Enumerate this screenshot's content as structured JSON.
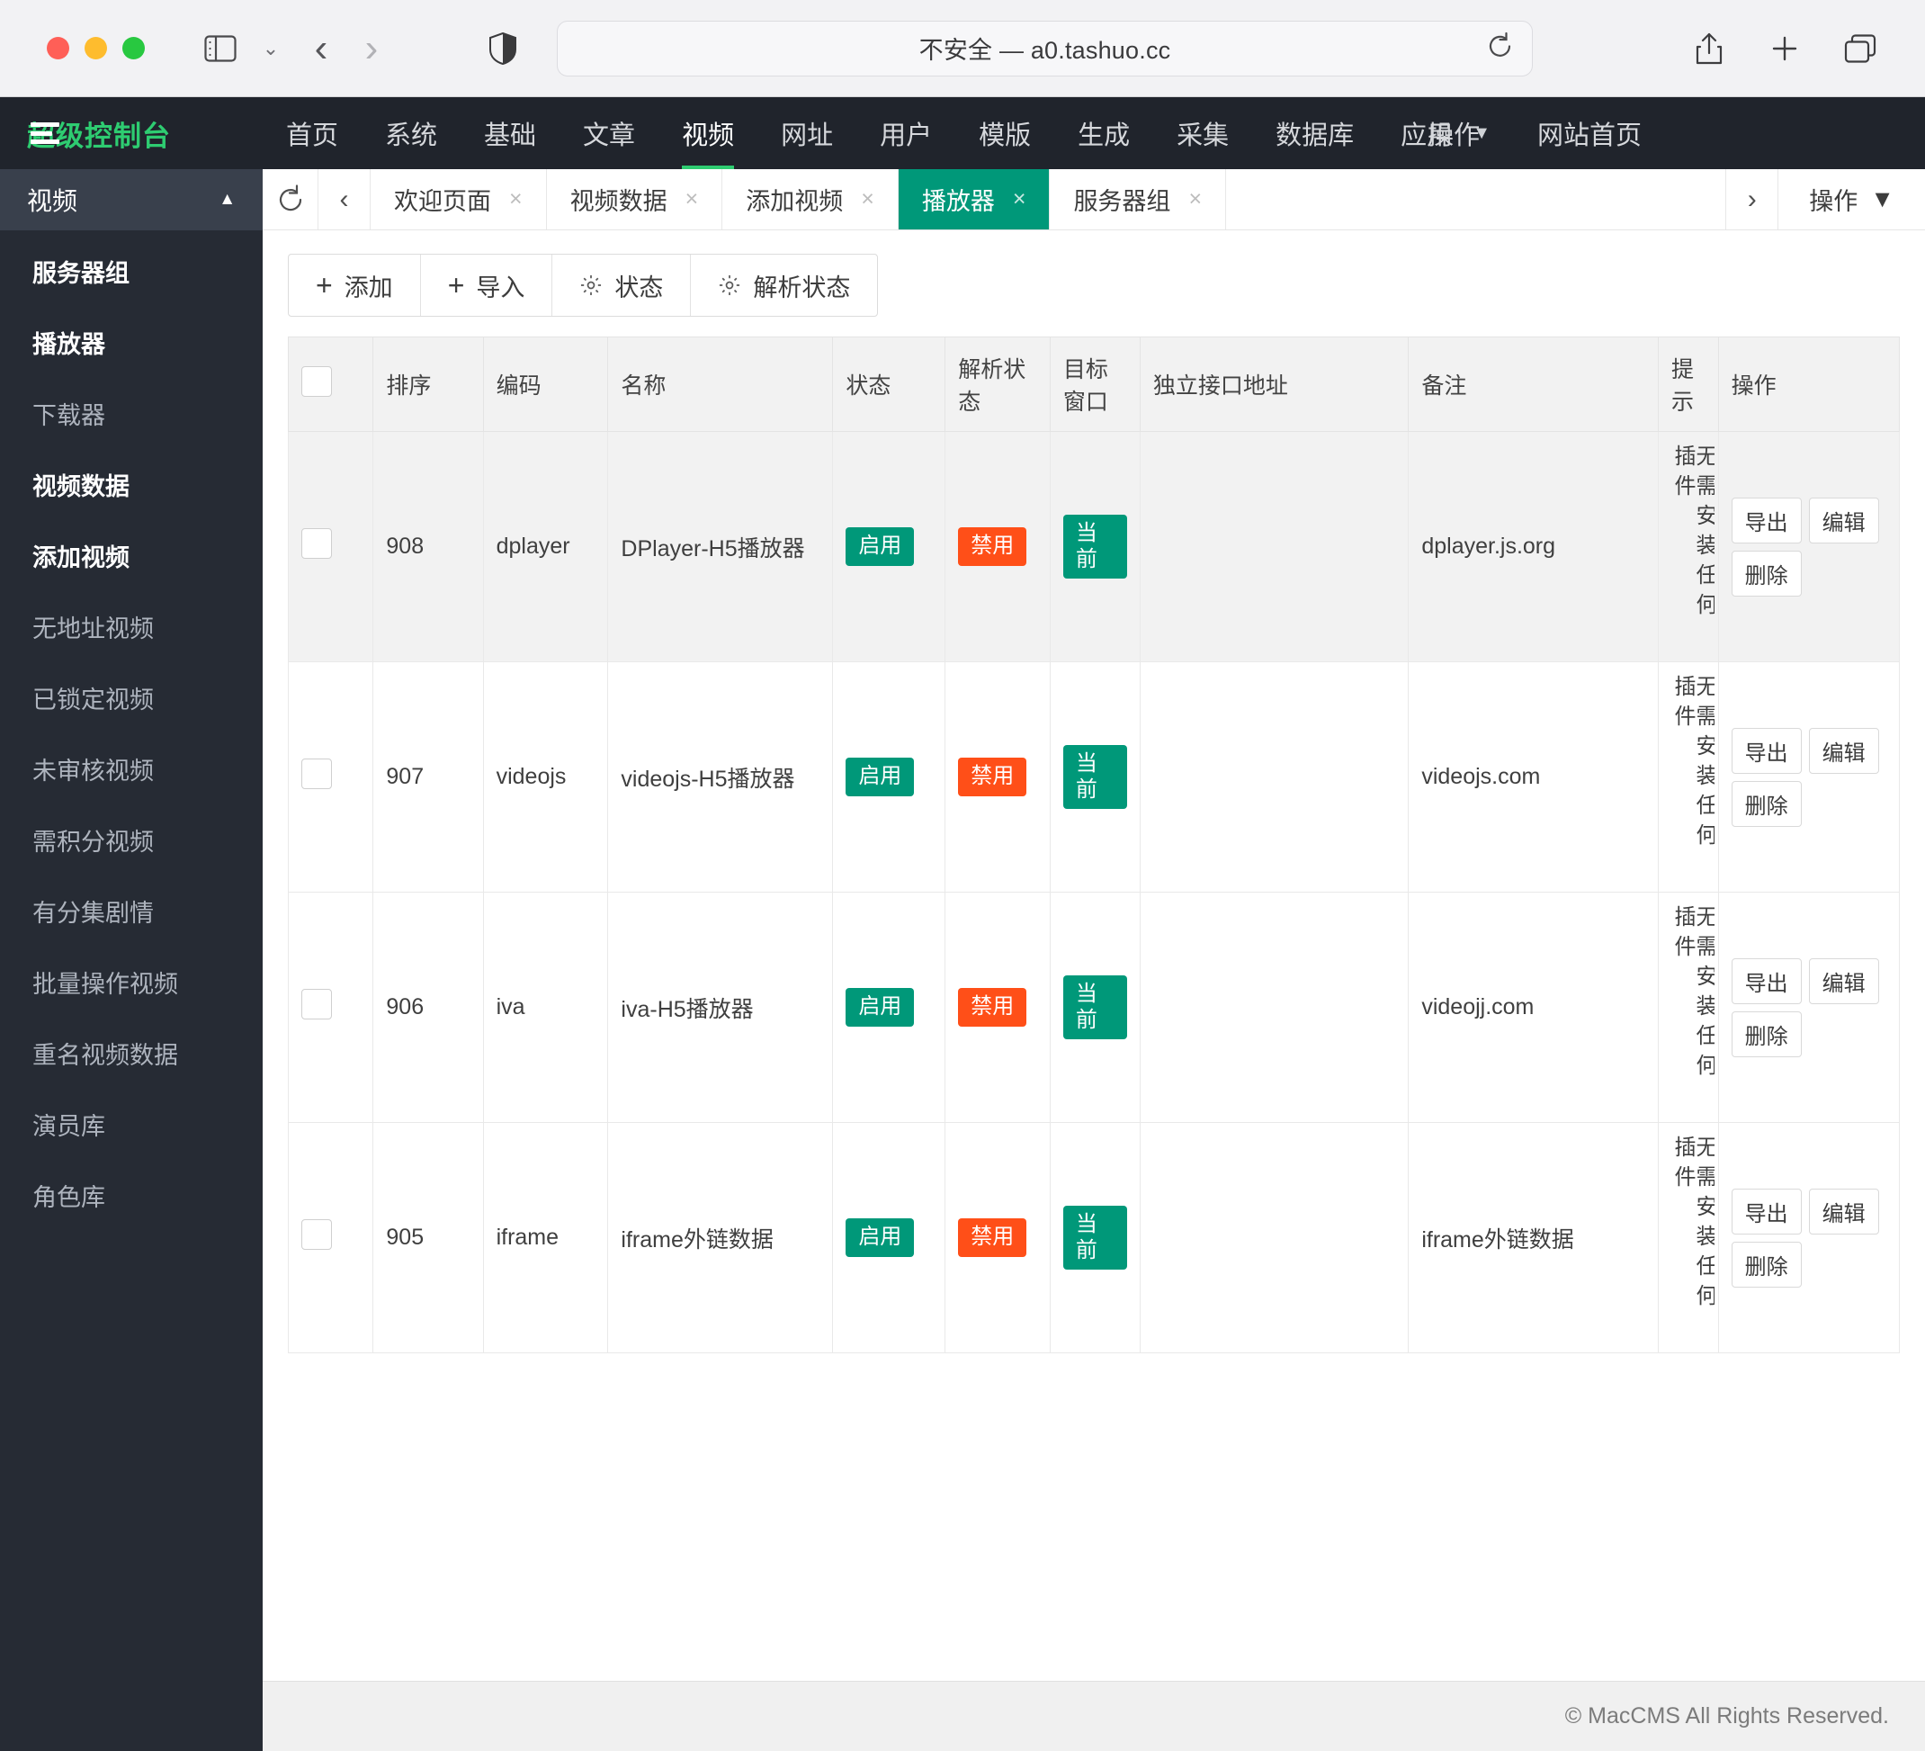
{
  "browser": {
    "url_text": "不安全 — a0.tashuo.cc",
    "icons": {
      "sidebar": "sidebar-toggle-icon",
      "sidebar_chevron": "chevron-down-icon",
      "back": "back-arrow-icon",
      "forward": "forward-arrow-icon",
      "shield": "privacy-shield-icon",
      "reload": "reload-icon",
      "share": "share-icon",
      "newtab": "new-tab-icon",
      "tabs": "show-tabs-icon"
    }
  },
  "topnav": {
    "logo": "超级控制台",
    "logo_color": "#2ecc71",
    "items": [
      {
        "label": "首页",
        "active": false
      },
      {
        "label": "系统",
        "active": false
      },
      {
        "label": "基础",
        "active": false
      },
      {
        "label": "文章",
        "active": false
      },
      {
        "label": "视频",
        "active": true
      },
      {
        "label": "网址",
        "active": false
      },
      {
        "label": "用户",
        "active": false
      },
      {
        "label": "模版",
        "active": false
      },
      {
        "label": "生成",
        "active": false
      },
      {
        "label": "采集",
        "active": false
      },
      {
        "label": "数据库",
        "active": false
      }
    ],
    "overlap_item": {
      "front": "应用",
      "back": "操作",
      "caret": "▼"
    },
    "site_home": "网站首页"
  },
  "sidebar": {
    "title": "视频",
    "collapse_icon": "▲",
    "items": [
      {
        "label": "服务器组",
        "strong": true
      },
      {
        "label": "播放器",
        "strong": true
      },
      {
        "label": "下载器",
        "strong": false
      },
      {
        "label": "视频数据",
        "strong": true
      },
      {
        "label": "添加视频",
        "strong": true
      },
      {
        "label": "无地址视频",
        "strong": false
      },
      {
        "label": "已锁定视频",
        "strong": false
      },
      {
        "label": "未审核视频",
        "strong": false
      },
      {
        "label": "需积分视频",
        "strong": false
      },
      {
        "label": "有分集剧情",
        "strong": false
      },
      {
        "label": "批量操作视频",
        "strong": false
      },
      {
        "label": "重名视频数据",
        "strong": false
      },
      {
        "label": "演员库",
        "strong": false
      },
      {
        "label": "角色库",
        "strong": false
      }
    ]
  },
  "tabbar": {
    "refresh_icon": "refresh-icon",
    "prev_icon": "‹",
    "next_icon": "›",
    "tabs": [
      {
        "label": "欢迎页面",
        "active": false
      },
      {
        "label": "视频数据",
        "active": false
      },
      {
        "label": "添加视频",
        "active": false
      },
      {
        "label": "播放器",
        "active": true
      },
      {
        "label": "服务器组",
        "active": false
      }
    ],
    "close_glyph": "×",
    "actions_label": "操作",
    "actions_caret": "▼"
  },
  "toolbar": {
    "buttons": [
      {
        "label": "添加",
        "icon": "plus-icon"
      },
      {
        "label": "导入",
        "icon": "plus-icon"
      },
      {
        "label": "状态",
        "icon": "gear-icon"
      },
      {
        "label": "解析状态",
        "icon": "gear-icon"
      }
    ]
  },
  "table": {
    "headers": [
      "",
      "排序",
      "编码",
      "名称",
      "状态",
      "解析状态",
      "目标窗口",
      "独立接口地址",
      "备注",
      "提示",
      "操作"
    ],
    "action_labels": {
      "export": "导出",
      "edit": "编辑",
      "delete": "删除"
    },
    "rows": [
      {
        "sort": "908",
        "code": "dplayer",
        "name": "DPlayer-H5播放器",
        "status": "启用",
        "parse_status": "禁用",
        "target_window": "当前",
        "api_url": "",
        "remark": "dplayer.js.org",
        "tip": "无需安装任何插件",
        "shaded": true
      },
      {
        "sort": "907",
        "code": "videojs",
        "name": "videojs-H5播放器",
        "status": "启用",
        "parse_status": "禁用",
        "target_window": "当前",
        "api_url": "",
        "remark": "videojs.com",
        "tip": "无需安装任何插件",
        "shaded": false
      },
      {
        "sort": "906",
        "code": "iva",
        "name": "iva-H5播放器",
        "status": "启用",
        "parse_status": "禁用",
        "target_window": "当前",
        "api_url": "",
        "remark": "videojj.com",
        "tip": "无需安装任何插件",
        "shaded": false
      },
      {
        "sort": "905",
        "code": "iframe",
        "name": "iframe外链数据",
        "status": "启用",
        "parse_status": "禁用",
        "target_window": "当前",
        "api_url": "",
        "remark": "iframe外链数据",
        "tip": "无需安装任何插件",
        "shaded": false
      }
    ]
  },
  "footer": {
    "copyright": "© MacCMS All Rights Reserved."
  },
  "colors": {
    "accent_green": "#009879",
    "danger_orange": "#ff4f18",
    "logo_green": "#2ecc71",
    "topnav_bg": "#20242c",
    "sidebar_bg": "#262b34"
  }
}
